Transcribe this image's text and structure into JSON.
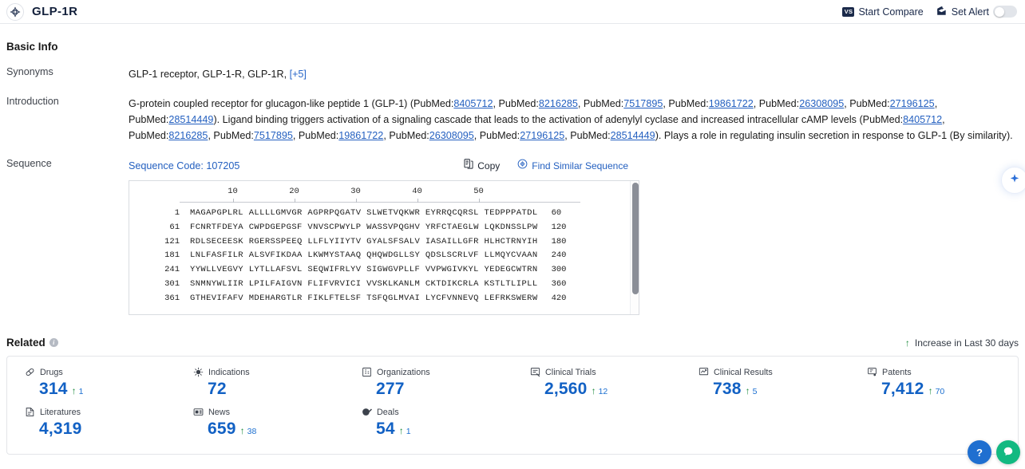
{
  "header": {
    "title": "GLP-1R",
    "logo_icon": "target-diamond-icon",
    "actions": [
      {
        "label": "Start Compare",
        "icon": "vs-badge-icon",
        "badge_text": "VS"
      },
      {
        "label": "Set Alert",
        "icon": "alert-mail-icon",
        "toggle_state": "off"
      }
    ]
  },
  "basic_info": {
    "title": "Basic Info",
    "synonyms": {
      "label": "Synonyms",
      "value": "GLP-1 receptor,  GLP-1-R,  GLP-1R,",
      "more": "[+5]"
    },
    "introduction": {
      "label": "Introduction",
      "part1": "G-protein coupled receptor for glucagon-like peptide 1 (GLP-1) (PubMed:",
      "refs1": [
        "8405712",
        "8216285",
        "7517895",
        "19861722",
        "26308095",
        "27196125",
        "28514449"
      ],
      "part2": "). Ligand binding triggers activation of a signaling cascade that leads to the activation of adenylyl cyclase and increased intracellular cAMP levels (PubMed:",
      "refs2": [
        "8405712",
        "8216285",
        "7517895",
        "19861722",
        "26308095",
        "27196125",
        "28514449"
      ],
      "part3": "). Plays a role in regulating insulin secretion in response to GLP-1 (By similarity).",
      "ref_prefix": "PubMed:"
    }
  },
  "sequence": {
    "label": "Sequence",
    "code_text": "Sequence Code: 107205",
    "copy_label": "Copy",
    "copy_icon": "copy-icon",
    "similar_label": "Find Similar Sequence",
    "similar_icon": "find-similar-icon",
    "ruler": [
      10,
      20,
      30,
      40,
      50
    ],
    "lines": [
      {
        "start": "1",
        "chunks": [
          "MAGAPGPLRL",
          "ALLLLGMVGR",
          "AGPRPQGATV",
          "SLWETVQKWR",
          "EYRRQCQRSL",
          "TEDPPPATDL"
        ],
        "end": "60"
      },
      {
        "start": "61",
        "chunks": [
          "FCNRTFDEYA",
          "CWPDGEPGSF",
          "VNVSCPWYLP",
          "WASSVPQGHV",
          "YRFCTAEGLW",
          "LQKDNSSLPW"
        ],
        "end": "120"
      },
      {
        "start": "121",
        "chunks": [
          "RDLSECEESK",
          "RGERSSPEEQ",
          "LLFLYIIYTV",
          "GYALSFSALV",
          "IASAILLGFR",
          "HLHCTRNYIH"
        ],
        "end": "180"
      },
      {
        "start": "181",
        "chunks": [
          "LNLFASFILR",
          "ALSVFIKDAA",
          "LKWMYSTAAQ",
          "QHQWDGLLSY",
          "QDSLSCRLVF",
          "LLMQYCVAAN"
        ],
        "end": "240"
      },
      {
        "start": "241",
        "chunks": [
          "YYWLLVEGVY",
          "LYTLLAFSVL",
          "SEQWIFRLYV",
          "SIGWGVPLLF",
          "VVPWGIVKYL",
          "YEDEGCWTRN"
        ],
        "end": "300"
      },
      {
        "start": "301",
        "chunks": [
          "SNMNYWLIIR",
          "LPILFAIGVN",
          "FLIFVRVICI",
          "VVSKLKANLM",
          "CKTDIKCRLA",
          "KSTLTLIPLL"
        ],
        "end": "360"
      },
      {
        "start": "361",
        "chunks": [
          "GTHEVIFAFV",
          "MDEHARGTLR",
          "FIKLFTELSF",
          "TSFQGLMVAI",
          "LYCFVNNEVQ",
          "LEFRKSWERW"
        ],
        "end": "420"
      }
    ]
  },
  "related": {
    "title": "Related",
    "info_icon": "info-icon",
    "legend_text": "Increase in Last 30 days",
    "legend_icon": "arrow-up-icon",
    "stats": [
      {
        "label": "Drugs",
        "icon": "pill-icon",
        "value": "314",
        "delta": "1"
      },
      {
        "label": "Indications",
        "icon": "virus-icon",
        "value": "72",
        "delta": ""
      },
      {
        "label": "Organizations",
        "icon": "building-icon",
        "value": "277",
        "delta": ""
      },
      {
        "label": "Clinical Trials",
        "icon": "clinical-trial-icon",
        "value": "2,560",
        "delta": "12"
      },
      {
        "label": "Clinical Results",
        "icon": "clinical-result-icon",
        "value": "738",
        "delta": "5"
      },
      {
        "label": "Patents",
        "icon": "patent-icon",
        "value": "7,412",
        "delta": "70"
      },
      {
        "label": "Literatures",
        "icon": "literature-icon",
        "value": "4,319",
        "delta": ""
      },
      {
        "label": "News",
        "icon": "news-icon",
        "value": "659",
        "delta": "38"
      },
      {
        "label": "Deals",
        "icon": "deal-icon",
        "value": "54",
        "delta": "1"
      }
    ]
  },
  "floating": {
    "side_icon": "assistant-icon",
    "buttons": [
      {
        "icon": "question-icon",
        "glyph": "?",
        "color": "#1f6fd0"
      },
      {
        "icon": "chat-icon",
        "glyph": "",
        "color": "#12b981"
      }
    ]
  }
}
